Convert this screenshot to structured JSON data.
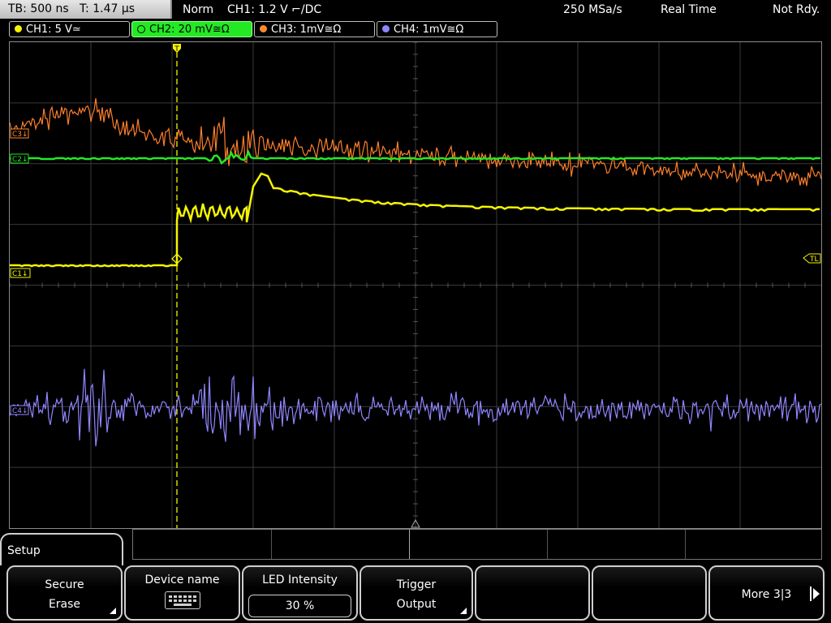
{
  "topbar": {
    "timebase": "TB: 500 ns",
    "trigger_time": "T: 1.47 µs",
    "trigger_mode": "Norm",
    "trigger_setting": "CH1: 1.2 V ⌐/DC",
    "sample_rate": "250 MSa/s",
    "acq_mode": "Real Time",
    "status": "Not Rdy."
  },
  "channels": [
    {
      "label": "CH1: 5 V≃",
      "color": "#f5f500"
    },
    {
      "label": "CH2: 20 mV≅Ω",
      "color": "#25e825"
    },
    {
      "label": "CH3: 1mV≅Ω",
      "color": "#ff8a30"
    },
    {
      "label": "CH4: 1mV≅Ω",
      "color": "#8f86ff"
    }
  ],
  "markers": {
    "ch1": "C1↓",
    "ch2": "C2↓",
    "ch3": "C3↓",
    "ch4": "C4↓",
    "trigger_level": "TL",
    "trigger_pos": "T"
  },
  "menu": {
    "title": "Setup",
    "keys": [
      {
        "l1": "Secure",
        "l2": "Erase"
      },
      {
        "l1": "Device name",
        "icon": "keyboard-icon"
      },
      {
        "l1": "LED Intensity",
        "value": "30 %"
      },
      {
        "l1": "Trigger",
        "l2": "Output"
      },
      {
        "l1": ""
      },
      {
        "l1": ""
      },
      {
        "l1": "More 3|3"
      }
    ]
  }
}
